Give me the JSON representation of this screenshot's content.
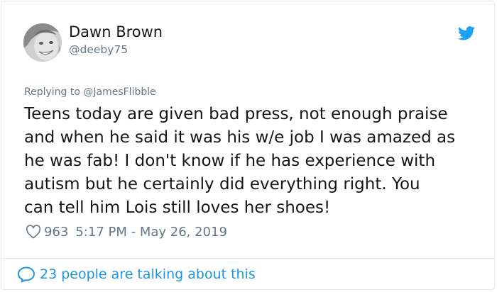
{
  "tweet": {
    "author": {
      "display_name": "Dawn Brown",
      "handle": "@deeby75",
      "avatar_icon": "profile-photo"
    },
    "platform_icon": "twitter-bird-icon",
    "reply_to": "Replying to @JamesFlibble",
    "text": "Teens today are given bad press, not enough praise\nand when he said it was his w/e job I was amazed as\nhe was fab! I don't know if he has experience with\nautism but he certainly did everything right.  You\ncan tell him Lois still loves her shoes!",
    "likes": "963",
    "timestamp": "5:17 PM - May 26, 2019",
    "talking": "23 people are talking about this"
  },
  "colors": {
    "text_primary": "#14171a",
    "text_secondary": "#657786",
    "link": "#1b95e0",
    "twitter_blue": "#1da1f2",
    "border": "#e1e8ed"
  }
}
